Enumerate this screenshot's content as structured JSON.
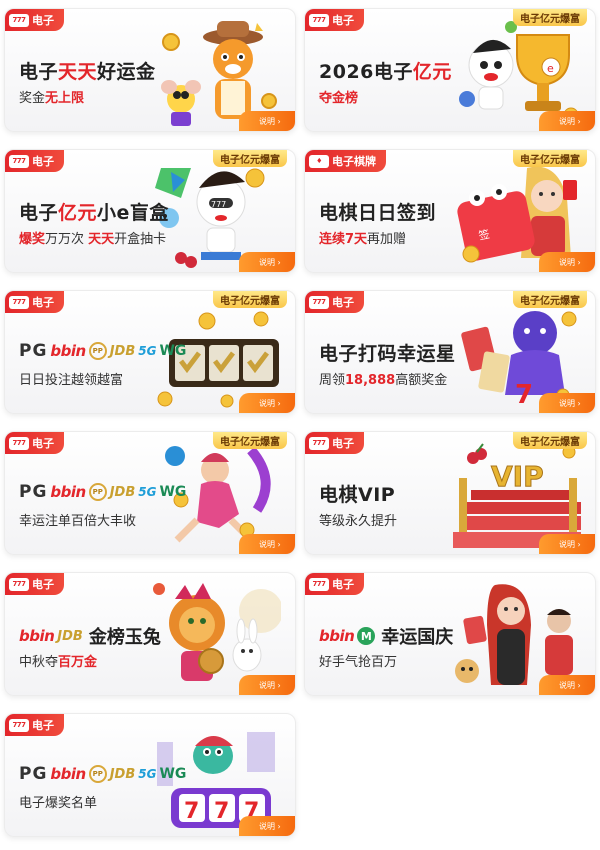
{
  "detail_label": "说明 ›",
  "cards": [
    {
      "category": "电子",
      "hot": "",
      "title_pre": "电子",
      "title_red": "天天",
      "title_post": "好运金",
      "sub_pre": "奖金",
      "sub_red": "无上限",
      "sub_post": "",
      "art": "tiger-mascot"
    },
    {
      "category": "电子",
      "hot": "电子亿元爆富",
      "title_pre": "2026电子",
      "title_red": "亿元",
      "title_post": "",
      "sub_pre": "夺金榜",
      "sub_red": "",
      "sub_post": "",
      "art": "trophy-mascot"
    },
    {
      "category": "电子",
      "hot": "电子亿元爆富",
      "title_pre": "电子",
      "title_red": "亿元",
      "title_post": "小e盲盒",
      "sub_pre": "",
      "sub_red": "爆奖",
      "sub_post": "万万次 ",
      "sub_red2": "天天",
      "sub_post2": "开盒抽卡",
      "art": "mascot-gift"
    },
    {
      "category": "电子棋牌",
      "hot": "电子亿元爆富",
      "title_pre": "电棋日日签到",
      "title_red": "",
      "title_post": "",
      "sub_pre": "",
      "sub_red": "连续7天",
      "sub_post": "再加赠",
      "art": "calendar-girl"
    },
    {
      "category": "电子",
      "hot": "电子亿元爆富",
      "brands": [
        "PG",
        "bbin",
        "PP",
        "JDB",
        "5G",
        "WG"
      ],
      "brand_title": "",
      "sub_pre": "日日投注越领越富",
      "sub_red": "",
      "sub_post": "",
      "art": "slot-reels"
    },
    {
      "category": "电子",
      "hot": "电子亿元爆富",
      "title_pre": "电子打码幸运星",
      "title_red": "",
      "title_post": "",
      "sub_pre": "周领",
      "sub_red": "18,888",
      "sub_post": "高额奖金",
      "art": "genie-cards"
    },
    {
      "category": "电子",
      "hot": "电子亿元爆富",
      "brands": [
        "PG",
        "bbin",
        "PP",
        "JDB",
        "5G",
        "WG"
      ],
      "brand_title": "",
      "sub_pre": "幸运注单百倍大丰收",
      "sub_red": "",
      "sub_post": "",
      "art": "dancer"
    },
    {
      "category": "电子",
      "hot": "电子亿元爆富",
      "title_pre": "电棋VIP",
      "title_red": "",
      "title_post": "",
      "sub_pre": "等级永久提升",
      "sub_red": "",
      "sub_post": "",
      "art": "vip-stage"
    },
    {
      "category": "电子",
      "hot": "",
      "brands": [
        "bbin",
        "JDB"
      ],
      "brand_title": "金榜玉兔",
      "sub_pre": "中秋夺",
      "sub_red": "百万金",
      "sub_post": "",
      "art": "lion-rabbit"
    },
    {
      "category": "电子",
      "hot": "",
      "brands": [
        "bbin",
        "MW"
      ],
      "brand_title": "幸运国庆",
      "sub_pre": "好手气抢百万",
      "sub_red": "",
      "sub_post": "",
      "art": "woman-man"
    },
    {
      "category": "电子",
      "hot": "",
      "brands": [
        "PG",
        "bbin",
        "PP",
        "JDB",
        "5G",
        "WG"
      ],
      "brand_title": "",
      "sub_pre": "电子爆奖名单",
      "sub_red": "",
      "sub_post": "",
      "art": "dino-777"
    }
  ]
}
